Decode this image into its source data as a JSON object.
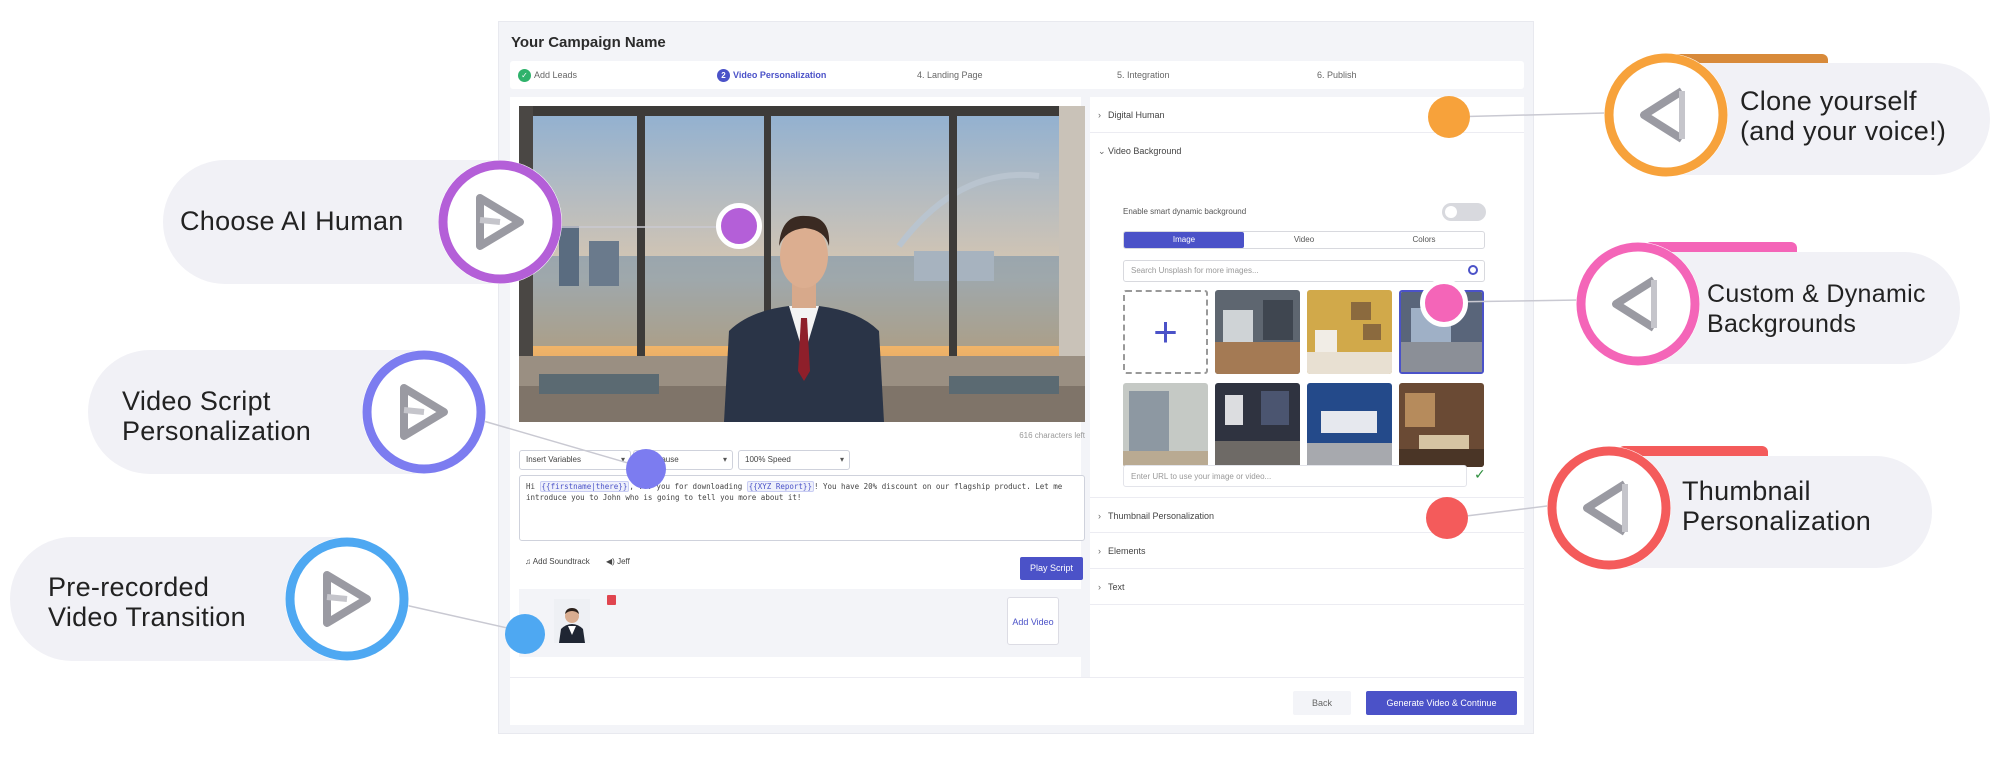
{
  "app": {
    "campaign_title": "Your Campaign Name",
    "steps": [
      {
        "label": "Add Leads",
        "badge": "✓",
        "state": "done"
      },
      {
        "label": "Video Personalization",
        "badge": "2",
        "state": "active"
      },
      {
        "label": "4. Landing Page",
        "badge": "",
        "state": "todo"
      },
      {
        "label": "5. Integration",
        "badge": "",
        "state": "todo"
      },
      {
        "label": "6. Publish",
        "badge": "",
        "state": "todo"
      }
    ],
    "characters_left": "616 characters left",
    "insert_variables_label": "Insert Variables",
    "pause_select_value": "Pause",
    "speed_select_value": "100% Speed",
    "script": {
      "t1": "Hi ",
      "v1": "{{firstname|there}}",
      "t2": ",",
      "t3": "... you for downloading ",
      "v2": "{{XYZ Report}}",
      "t4": "! You have 20% discount on our flagship product. Let me",
      "line2": "introduce you to John who is going to tell you more about it!"
    },
    "add_soundtrack_label": "Add Soundtrack",
    "voice_label": "Jeff",
    "play_script_label": "Play Script",
    "add_video_label": "Add Video",
    "digital_human_label": "Digital Human",
    "video_background_label": "Video Background",
    "smart_bg_label": "Enable smart dynamic background",
    "smart_bg_enabled": false,
    "bg_tabs": [
      "Image",
      "Video",
      "Colors"
    ],
    "bg_tab_selected": "Image",
    "search_placeholder": "Search Unsplash for more images...",
    "url_placeholder": "Enter URL to use your image or video...",
    "thumbnail_label": "Thumbnail Personalization",
    "elements_label": "Elements",
    "text_label": "Text",
    "back_label": "Back",
    "generate_label": "Generate Video & Continue",
    "accent_color": "#4b52c8"
  },
  "callouts": [
    {
      "id": "ai-human",
      "text_lines": [
        "Choose AI Human"
      ],
      "color": "#b45fd8"
    },
    {
      "id": "script",
      "text_lines": [
        "Video Script",
        "Personalization"
      ],
      "color": "#7c7cf0"
    },
    {
      "id": "transition",
      "text_lines": [
        "Pre-recorded",
        "Video Transition"
      ],
      "color": "#4ea8f2"
    },
    {
      "id": "clone",
      "text_lines": [
        "Clone yourself",
        "(and your voice!)"
      ],
      "color": "#f7a23b"
    },
    {
      "id": "backgrounds",
      "text_lines": [
        "Custom & Dynamic",
        "Backgrounds"
      ],
      "color": "#f465b8"
    },
    {
      "id": "thumbnail",
      "text_lines": [
        "Thumbnail",
        "Personalization"
      ],
      "color": "#f45b5b"
    }
  ]
}
